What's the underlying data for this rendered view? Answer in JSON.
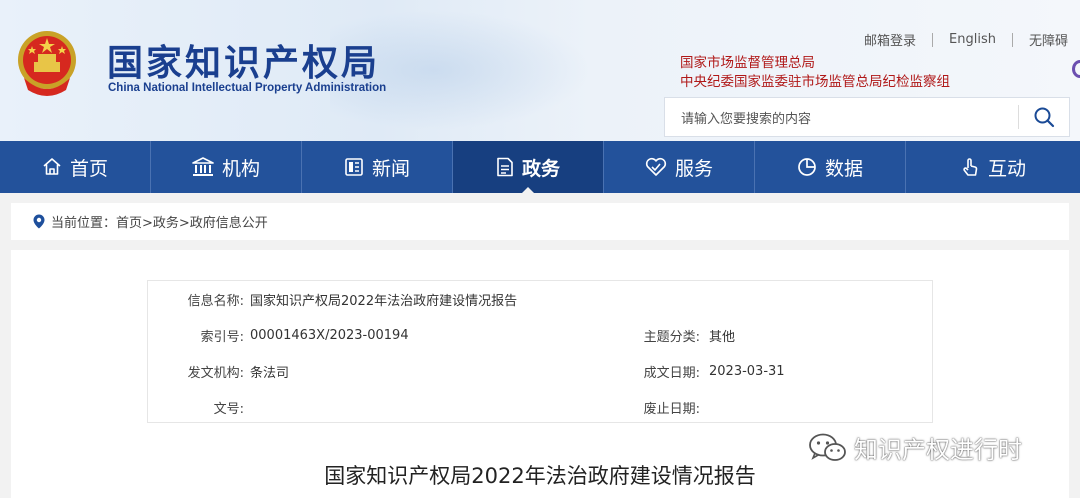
{
  "header": {
    "logo_cn": "国家知识产权局",
    "logo_en": "China National Intellectual Property Administration",
    "toplinks": [
      "邮箱登录",
      "English",
      "无障碍"
    ],
    "org_line1": "国家市场监督管理总局",
    "org_line2": "中央纪委国家监委驻市场监管总局纪检监察组",
    "search_placeholder": "请输入您要搜索的内容"
  },
  "nav": {
    "items": [
      {
        "label": "首页",
        "icon": "home-icon"
      },
      {
        "label": "机构",
        "icon": "building-icon"
      },
      {
        "label": "新闻",
        "icon": "news-icon"
      },
      {
        "label": "政务",
        "icon": "document-icon",
        "active": true
      },
      {
        "label": "服务",
        "icon": "service-icon"
      },
      {
        "label": "数据",
        "icon": "pie-chart-icon"
      },
      {
        "label": "互动",
        "icon": "hand-icon"
      }
    ]
  },
  "breadcrumb": {
    "prefix": "当前位置：",
    "path": "首页>政务>政府信息公开"
  },
  "info": {
    "name_label": "信息名称:",
    "name_value": "国家知识产权局2022年法治政府建设情况报告",
    "index_label": "索引号:",
    "index_value": "00001463X/2023-00194",
    "topic_label": "主题分类:",
    "topic_value": "其他",
    "issuer_label": "发文机构:",
    "issuer_value": "条法司",
    "date_label": "成文日期:",
    "date_value": "2023-03-31",
    "docno_label": "文号:",
    "docno_value": "",
    "expire_label": "废止日期:",
    "expire_value": ""
  },
  "doc_title": "国家知识产权局2022年法治政府建设情况报告",
  "watermark": "知识产权进行时",
  "colors": {
    "nav_bg": "#23529b",
    "nav_active": "#173f80",
    "logo_blue": "#1a3f8f",
    "org_red": "#b01818"
  }
}
